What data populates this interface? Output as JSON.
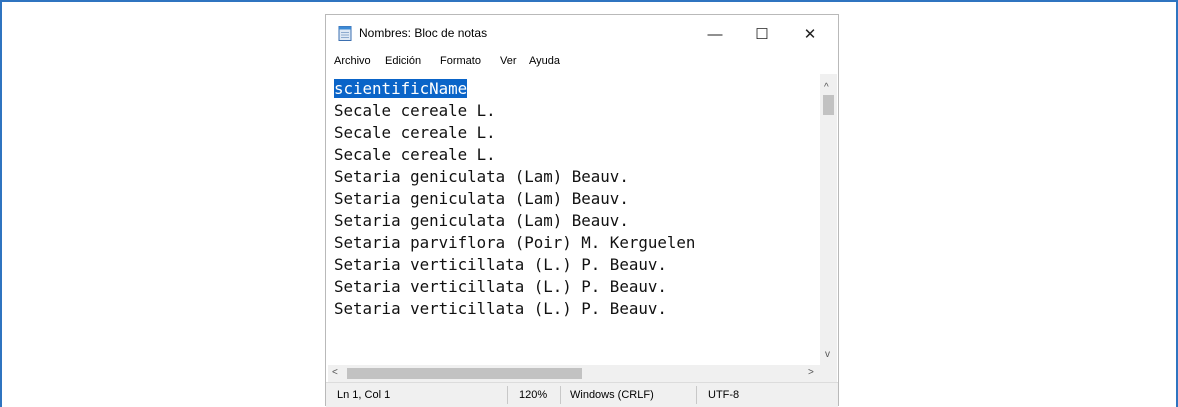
{
  "window": {
    "title": "Nombres: Bloc de notas",
    "controls": {
      "minimize": "—",
      "maximize": "☐",
      "close": "✕"
    }
  },
  "menu": [
    "Archivo",
    "Edición",
    "Formato",
    "Ver",
    "Ayuda"
  ],
  "editor": {
    "lines": [
      "scientificName",
      "Secale cereale L.",
      "Secale cereale L.",
      "Secale cereale L.",
      "Setaria geniculata (Lam) Beauv.",
      "Setaria geniculata (Lam) Beauv.",
      "Setaria geniculata (Lam) Beauv.",
      "Setaria parviflora (Poir) M. Kerguelen",
      "Setaria verticillata (L.) P. Beauv.",
      "Setaria verticillata (L.) P. Beauv.",
      "Setaria verticillata (L.) P. Beauv."
    ],
    "selected_line": 0
  },
  "scrollbars": {
    "up": "^",
    "down": "v",
    "left": "<",
    "right": ">"
  },
  "status": {
    "position": "Ln 1, Col 1",
    "zoom": "120%",
    "line_ending": "Windows (CRLF)",
    "encoding": "UTF-8"
  },
  "colors": {
    "frame_border": "#2f74c0",
    "selection": "#0a64c8"
  }
}
